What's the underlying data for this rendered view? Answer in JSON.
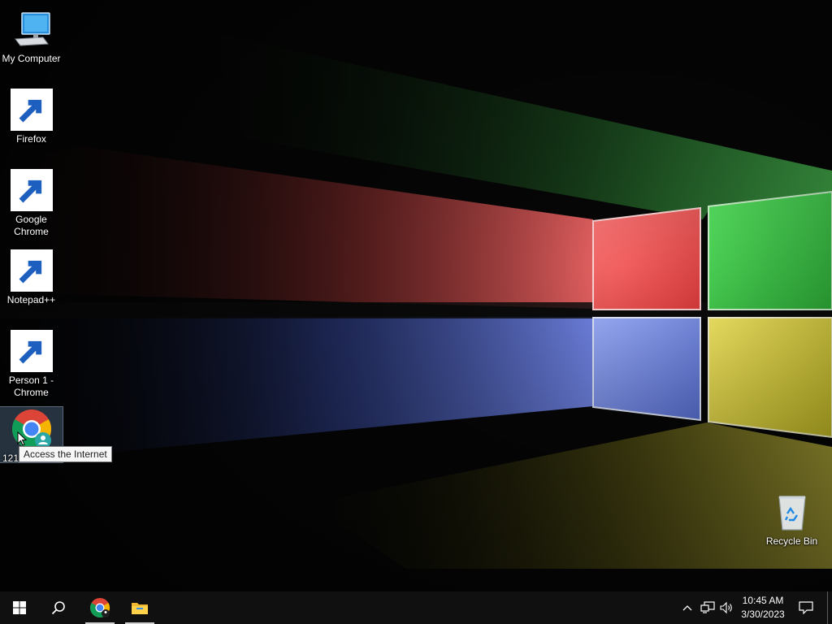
{
  "desktop": {
    "icons": [
      {
        "label": "My Computer"
      },
      {
        "label": "Firefox"
      },
      {
        "label": "Google\nChrome"
      },
      {
        "label": "Notepad++"
      },
      {
        "label": "Person 1 -\nChrome"
      },
      {
        "label": "121"
      }
    ],
    "recycle_bin": {
      "label": "Recycle Bin"
    },
    "tooltip": "Access the Internet"
  },
  "taskbar": {
    "time": "10:45 AM",
    "date": "3/30/2023",
    "icons": {
      "start": "windows-logo-icon",
      "search": "search-icon",
      "chrome": "chrome-icon",
      "explorer": "file-explorer-icon",
      "tray_chevron": "chevron-up-icon",
      "network": "network-icon",
      "volume": "volume-icon",
      "notifications": "notification-icon"
    }
  },
  "colors": {
    "taskbar_bg": "#101010",
    "pane_red": "#f05050",
    "pane_green": "#3ecf4a",
    "pane_blue": "#6a86e8",
    "pane_yellow": "#e0d83a"
  }
}
